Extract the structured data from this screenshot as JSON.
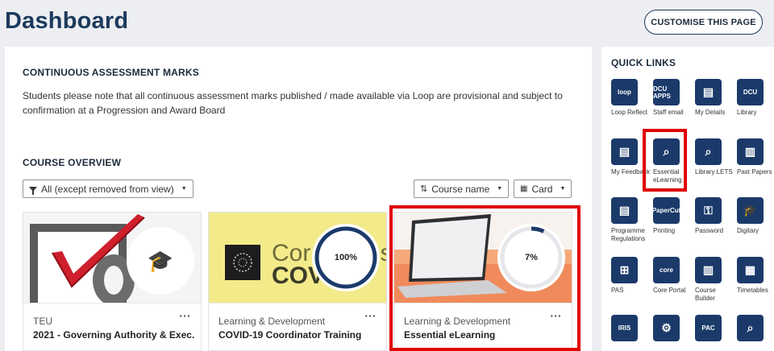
{
  "header": {
    "title": "Dashboard",
    "customise_label": "CUSTOMISE THIS PAGE"
  },
  "assessment": {
    "heading": "CONTINUOUS ASSESSMENT MARKS",
    "notice": "Students please note that all continuous assessment marks published / made available via Loop are provisional and subject to confirmation at a Progression and Award Board"
  },
  "overview": {
    "heading": "COURSE OVERVIEW",
    "filter_label": "All (except removed from view)",
    "sort_label": "Course name",
    "view_label": "Card"
  },
  "courses": [
    {
      "category": "TEU",
      "name": "2021 - Governing Authority & Exec...",
      "progress_text": "",
      "progress": null,
      "menu": "···"
    },
    {
      "category": "Learning & Development",
      "name": "COVID-19 Coordinator Training",
      "progress_text": "100%",
      "progress": 1.0,
      "image_text_top": "Cor",
      "image_text_top2": "us",
      "image_text_bottom": "COV",
      "menu": "···"
    },
    {
      "category": "Learning & Development",
      "name": "Essential eLearning",
      "progress_text": "7%",
      "progress": 0.07,
      "menu": "···"
    }
  ],
  "quick_links": {
    "heading": "QUICK LINKS",
    "items": [
      {
        "label": "Loop Reflect",
        "icon": "loop-reflect-icon",
        "icon_text": "loop"
      },
      {
        "label": "Staff email",
        "icon": "staff-email-icon",
        "icon_text": "DCU APPS"
      },
      {
        "label": "My Details",
        "icon": "id-card-icon",
        "icon_text": ""
      },
      {
        "label": "Library",
        "icon": "dcu-library-icon",
        "icon_text": "DCU"
      },
      {
        "label": "My Feedback",
        "icon": "feedback-document-icon",
        "icon_text": ""
      },
      {
        "label": "Essential eLearning",
        "icon": "chart-search-icon",
        "icon_text": ""
      },
      {
        "label": "Library LETS",
        "icon": "chart-search-icon",
        "icon_text": ""
      },
      {
        "label": "Past Papers",
        "icon": "papers-icon",
        "icon_text": ""
      },
      {
        "label": "Programme Regulations",
        "icon": "regulations-icon",
        "icon_text": ""
      },
      {
        "label": "Printing",
        "icon": "papercut-icon",
        "icon_text": "PaperCut"
      },
      {
        "label": "Password",
        "icon": "password-icon",
        "icon_text": ""
      },
      {
        "label": "Digitary",
        "icon": "graduation-cap-icon",
        "icon_text": ""
      },
      {
        "label": "PAS",
        "icon": "org-chart-icon",
        "icon_text": ""
      },
      {
        "label": "Core Portal",
        "icon": "core-icon",
        "icon_text": "core"
      },
      {
        "label": "Course Builder",
        "icon": "course-builder-icon",
        "icon_text": ""
      },
      {
        "label": "Timetables",
        "icon": "calendar-icon",
        "icon_text": ""
      },
      {
        "label": "",
        "icon": "iris-icon",
        "icon_text": "IRIS"
      },
      {
        "label": "",
        "icon": "document-settings-icon",
        "icon_text": ""
      },
      {
        "label": "",
        "icon": "pac-icon",
        "icon_text": "PAC"
      },
      {
        "label": "",
        "icon": "chart-search-icon",
        "icon_text": ""
      }
    ]
  },
  "colors": {
    "accent": "#1b3a5c",
    "icon_bg": "#1b3a6a",
    "highlight": "#e00000",
    "progress": "#1b3a6a"
  }
}
